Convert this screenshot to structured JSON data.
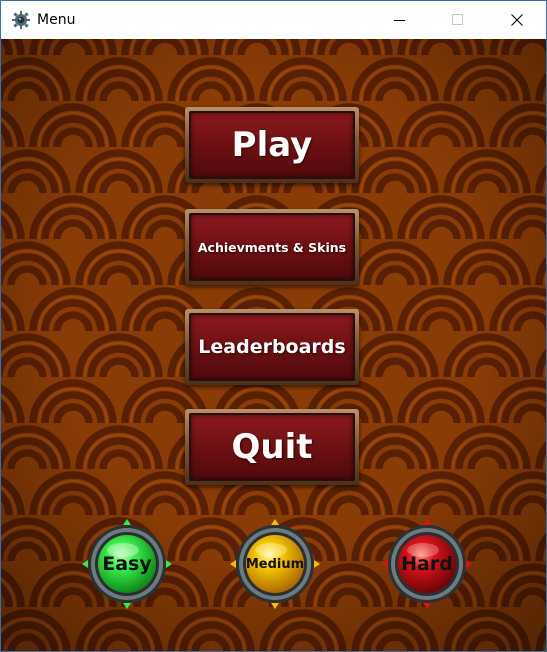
{
  "window": {
    "title": "Menu",
    "icon": "gear-app-icon",
    "controls": [
      "minimize",
      "maximize",
      "close"
    ]
  },
  "menu": {
    "play_label": "Play",
    "achievements_label": "Achievments & Skins",
    "leaderboards_label": "Leaderboards",
    "quit_label": "Quit"
  },
  "difficulty": {
    "easy_label": "Easy",
    "medium_label": "Medium",
    "hard_label": "Hard",
    "easy_color": "#22e03a",
    "medium_color": "#f0b400",
    "hard_color": "#cc0a0f"
  },
  "colors": {
    "background": "#8a3c06",
    "swirl_dark": "#5a2003",
    "button_face": "#6b0f13",
    "button_frame": "#7f5936"
  }
}
